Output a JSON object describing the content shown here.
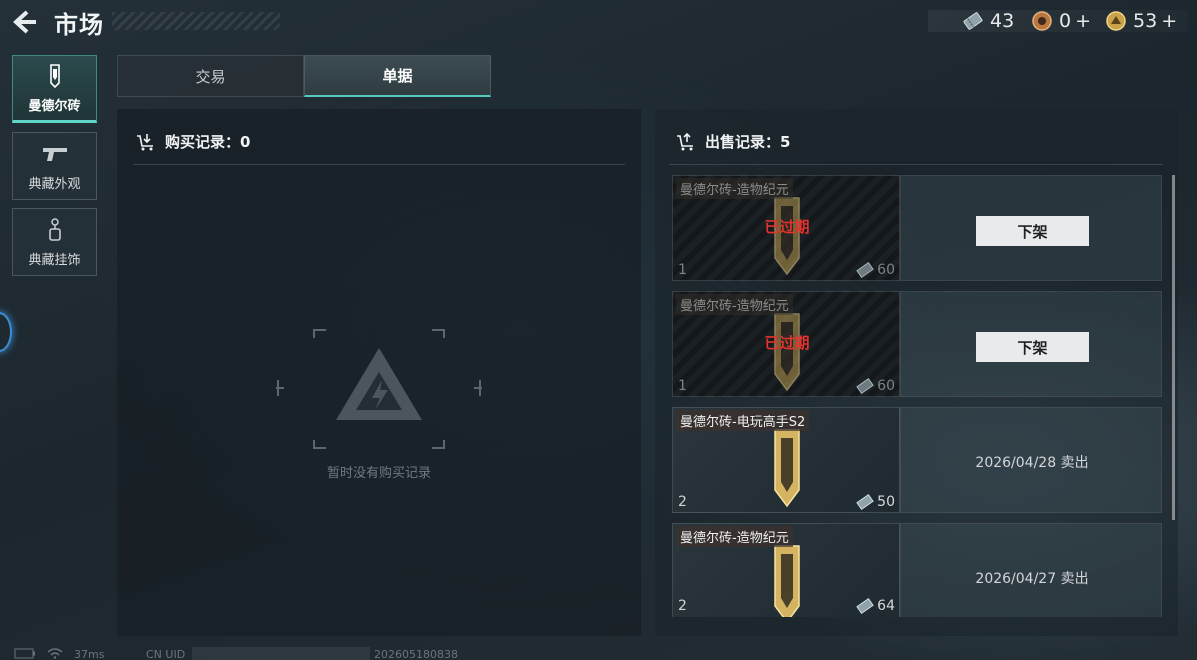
{
  "header": {
    "title": "市场",
    "currencies": [
      {
        "icon": "ticket-icon",
        "amount": "43",
        "plus": ""
      },
      {
        "icon": "coin-bronze-icon",
        "amount": "0",
        "plus": "+"
      },
      {
        "icon": "coin-gold-icon",
        "amount": "53",
        "plus": "+"
      }
    ]
  },
  "categories": [
    {
      "label": "曼德尔砖",
      "icon": "mandel-brick-icon",
      "active": true
    },
    {
      "label": "典藏外观",
      "icon": "pistol-icon",
      "active": false
    },
    {
      "label": "典藏挂饰",
      "icon": "charm-icon",
      "active": false
    }
  ],
  "tabs": {
    "trade": "交易",
    "orders": "单据",
    "active": "orders"
  },
  "buy": {
    "title": "购买记录：",
    "count": "0",
    "empty_text": "暂时没有购买记录"
  },
  "sell": {
    "title": "出售记录：",
    "count": "5",
    "records": [
      {
        "name": "曼德尔砖-造物纪元",
        "qty": "1",
        "price": "60",
        "status": "已过期",
        "action": "下架",
        "sold_text": ""
      },
      {
        "name": "曼德尔砖-造物纪元",
        "qty": "1",
        "price": "60",
        "status": "已过期",
        "action": "下架",
        "sold_text": ""
      },
      {
        "name": "曼德尔砖-电玩高手S2",
        "qty": "2",
        "price": "50",
        "status": "",
        "action": "",
        "sold_text": "2026/04/28 卖出"
      },
      {
        "name": "曼德尔砖-造物纪元",
        "qty": "2",
        "price": "64",
        "status": "",
        "action": "",
        "sold_text": "2026/04/27 卖出"
      }
    ]
  },
  "footer": {
    "ping": "37ms",
    "uid_label": "CN UID",
    "build": "202605180838"
  },
  "colors": {
    "accent": "#57c9bc",
    "expired": "#e2332c",
    "button_bg": "#e9eaeb"
  }
}
